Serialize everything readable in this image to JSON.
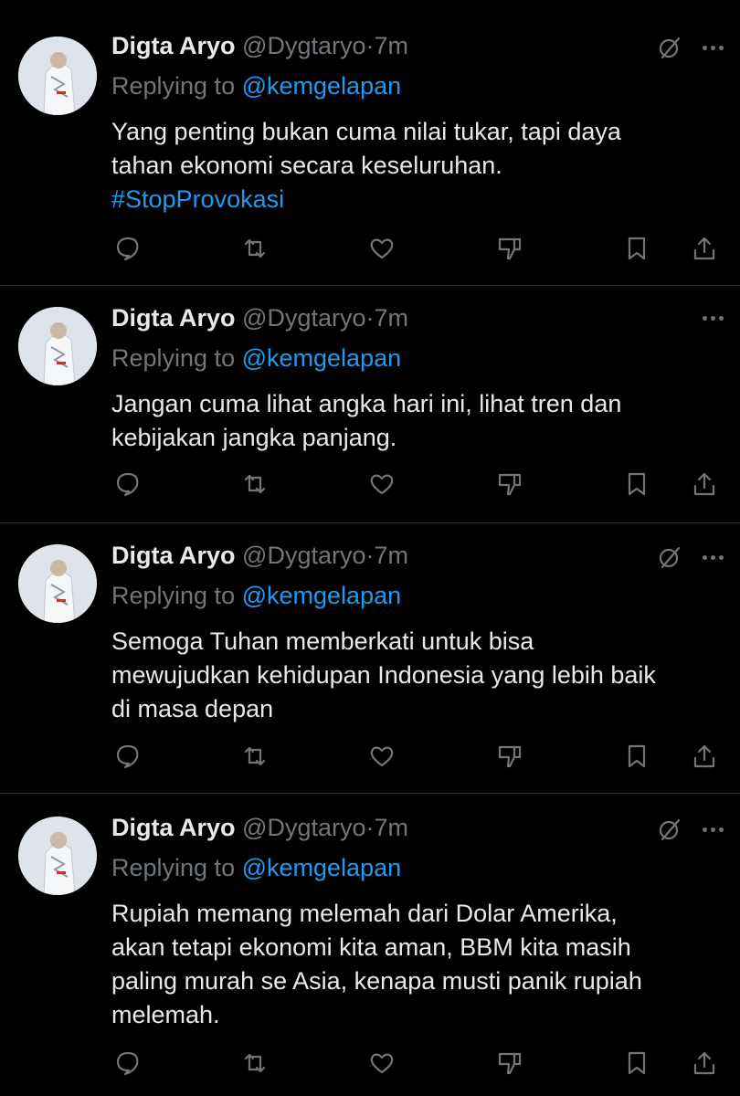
{
  "tweets": [
    {
      "author": "Digta Aryo",
      "handle": "@Dygtaryo",
      "dot": "·",
      "time": "7m",
      "replying_prefix": "Replying to",
      "replying_to": "@kemgelapan",
      "text_lines": [
        "Yang penting bukan cuma nilai tukar, tapi daya",
        "tahan ekonomi secara keseluruhan."
      ],
      "hashtag": "#StopProvokasi",
      "has_grok_icon": true
    },
    {
      "author": "Digta Aryo",
      "handle": "@Dygtaryo",
      "dot": "·",
      "time": "7m",
      "replying_prefix": "Replying to",
      "replying_to": "@kemgelapan",
      "text_lines": [
        "Jangan cuma lihat angka hari ini, lihat tren dan",
        "kebijakan jangka panjang."
      ],
      "hashtag": "",
      "has_grok_icon": false
    },
    {
      "author": "Digta Aryo",
      "handle": "@Dygtaryo",
      "dot": "·",
      "time": "7m",
      "replying_prefix": "Replying to",
      "replying_to": "@kemgelapan",
      "text_lines": [
        "Semoga Tuhan memberkati untuk bisa",
        "mewujudkan kehidupan Indonesia yang lebih baik",
        "di masa depan"
      ],
      "hashtag": "",
      "has_grok_icon": true
    },
    {
      "author": "Digta Aryo",
      "handle": "@Dygtaryo",
      "dot": "·",
      "time": "7m",
      "replying_prefix": "Replying to",
      "replying_to": "@kemgelapan",
      "text_lines": [
        "Rupiah memang melemah dari Dolar Amerika,",
        "akan tetapi ekonomi kita aman, BBM kita masih",
        "paling murah se Asia, kenapa musti panik rupiah",
        "melemah."
      ],
      "hashtag": "",
      "has_grok_icon": true
    }
  ],
  "icons": {
    "reply": "reply-icon",
    "retweet": "retweet-icon",
    "like": "like-icon",
    "downvote": "downvote-icon",
    "bookmark": "bookmark-icon",
    "share": "share-icon",
    "grok": "grok-icon",
    "more": "more-icon"
  },
  "colors": {
    "background": "#000000",
    "text": "#e7e9ea",
    "muted": "#71767b",
    "accent": "#1d9bf0",
    "divider": "#2f3336"
  }
}
